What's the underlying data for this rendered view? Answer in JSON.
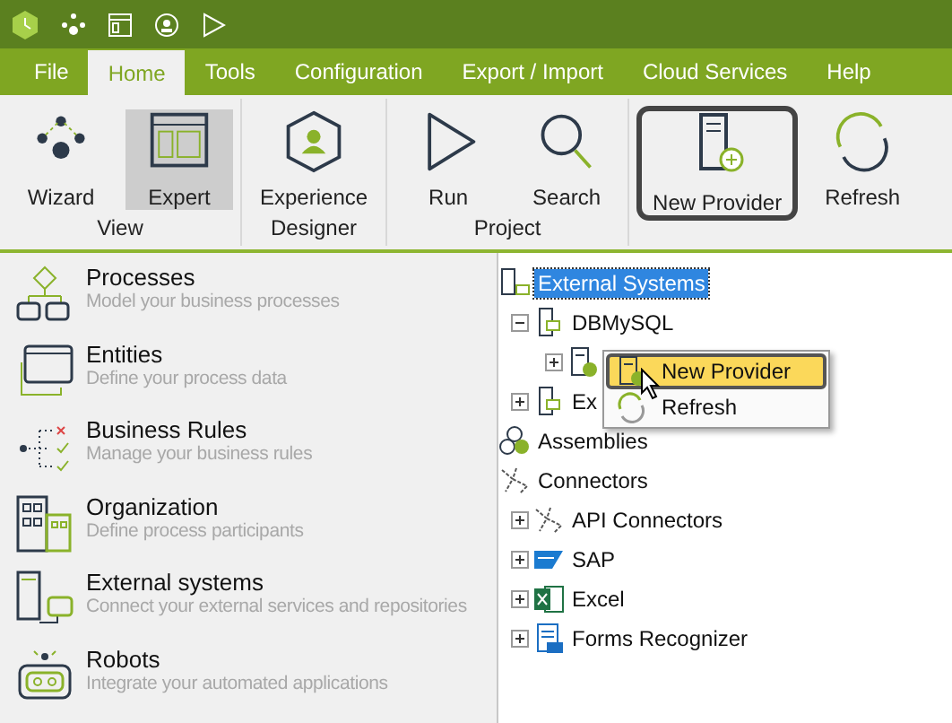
{
  "menu_tabs": [
    {
      "label": "File",
      "selected": false
    },
    {
      "label": "Home",
      "selected": true
    },
    {
      "label": "Tools",
      "selected": false
    },
    {
      "label": "Configuration",
      "selected": false
    },
    {
      "label": "Export / Import",
      "selected": false
    },
    {
      "label": "Cloud Services",
      "selected": false
    },
    {
      "label": "Help",
      "selected": false
    }
  ],
  "ribbon": {
    "groups": [
      {
        "label": "View",
        "buttons": [
          {
            "label": "Wizard",
            "kind": "wizard",
            "selected": false,
            "highlighted": false
          },
          {
            "label": "Expert",
            "kind": "expert",
            "selected": true,
            "highlighted": false
          }
        ]
      },
      {
        "label": "Designer",
        "buttons": [
          {
            "label": "Experience",
            "kind": "experience",
            "selected": false,
            "highlighted": false
          }
        ]
      },
      {
        "label": "Project",
        "buttons": [
          {
            "label": "Run",
            "kind": "run",
            "selected": false,
            "highlighted": false
          },
          {
            "label": "Search",
            "kind": "search",
            "selected": false,
            "highlighted": false
          }
        ]
      },
      {
        "buttons": [
          {
            "label": "New Provider",
            "kind": "provider",
            "selected": false,
            "highlighted": true
          },
          {
            "label": "Refresh",
            "kind": "refresh",
            "selected": false,
            "highlighted": false
          }
        ]
      }
    ]
  },
  "modules": [
    {
      "kind": "processes",
      "title": "Processes",
      "description": "Model your business processes"
    },
    {
      "kind": "entities",
      "title": "Entities",
      "description": "Define your process data"
    },
    {
      "kind": "rules",
      "title": "Business Rules",
      "description": "Manage your business rules"
    },
    {
      "kind": "organization",
      "title": "Organization",
      "description": "Define process participants"
    },
    {
      "kind": "external",
      "title": "External systems",
      "description": "Connect your external services and repositories"
    },
    {
      "kind": "robots",
      "title": "Robots",
      "description": "Integrate your automated applications"
    }
  ],
  "tree": {
    "items": [
      {
        "label": "External Systems",
        "kind": "external",
        "selected": true,
        "children": [
          {
            "label": "DBMySQL",
            "kind": "db",
            "selected": false,
            "expanded": true,
            "children": [
              {
                "kind": "provider",
                "expanded": false
              }
            ]
          },
          {
            "label": "Ex",
            "kind": "db",
            "selected": false,
            "expanded": false
          }
        ]
      },
      {
        "label": "Assemblies",
        "kind": "assemblies",
        "selected": false
      },
      {
        "label": "Connectors",
        "kind": "connectors",
        "selected": false,
        "children": [
          {
            "label": "API Connectors",
            "kind": "connectors",
            "selected": false,
            "expanded": false
          },
          {
            "label": "SAP",
            "kind": "sap",
            "selected": false,
            "expanded": false
          },
          {
            "label": "Excel",
            "kind": "excel",
            "selected": false,
            "expanded": false
          },
          {
            "label": "Forms Recognizer",
            "kind": "forms",
            "selected": false,
            "expanded": false
          }
        ]
      }
    ]
  },
  "context_menu": {
    "items": [
      {
        "label": "New Provider",
        "kind": "provider",
        "selected": true
      },
      {
        "label": "Refresh",
        "kind": "refresh",
        "selected": false
      }
    ]
  }
}
